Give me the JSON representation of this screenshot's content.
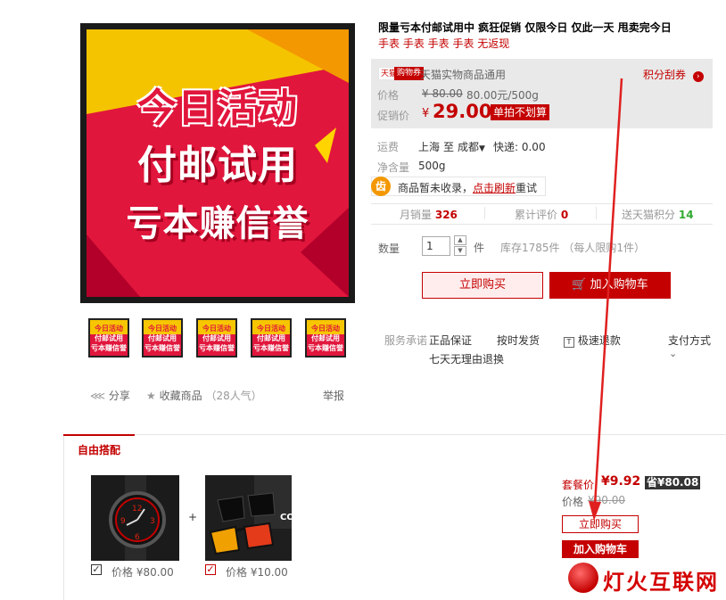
{
  "product": {
    "title": "限量亏本付邮试用中 疯狂促销 仅限今日 仅此一天 甩卖完今日",
    "subtitle": "手表 手表 手表 手表 无返现",
    "main_image_lines": [
      "今日活动",
      "付邮试用",
      "亏本赚信誉"
    ],
    "thumbnail_lines": [
      "今日活动",
      "付邮试用",
      "亏本赚信誉"
    ]
  },
  "price_panel": {
    "tmall_badge": "天猫",
    "badge2": "购物券",
    "coupon_text": "天猫实物商品通用",
    "points_link": "积分刮券",
    "price_label": "价格",
    "original_price": "¥ 80.00",
    "unit_price": "80.00元/500g",
    "promo_label": "促销价",
    "currency": "¥",
    "promo_price": "29.00",
    "promo_tag": "单拍不划算"
  },
  "shipping": {
    "label": "运费",
    "from": "上海",
    "to_word": "至",
    "to": "成都",
    "express": "快递: 0.00",
    "net_label": "净含量",
    "net_value": "500g"
  },
  "notice": {
    "icon_char": "齿",
    "text": "商品暂未收录，",
    "link": "点击刷新",
    "suffix": "重试"
  },
  "stats": {
    "monthly_label": "月销量",
    "monthly_value": "326",
    "reviews_label": "累计评价",
    "reviews_value": "0",
    "points_label": "送天猫积分",
    "points_value": "14"
  },
  "quantity": {
    "label": "数量",
    "value": "1",
    "unit": "件",
    "stock": "库存1785件 （每人限购1件）"
  },
  "buttons": {
    "buy_now": "立即购买",
    "add_cart": "加入购物车"
  },
  "services": {
    "label": "服务承诺",
    "genuine": "正品保证",
    "on_time": "按时发货",
    "fast_refund": "极速退款",
    "return7": "七天无理由退换",
    "payment": "支付方式"
  },
  "social": {
    "share": "分享",
    "favorite": "收藏商品",
    "popularity": "（28人气）",
    "report": "举报"
  },
  "combo": {
    "tab_label": "自由搭配",
    "items": [
      {
        "price": "价格 ¥80.00",
        "checked": true
      },
      {
        "price": "价格 ¥10.00",
        "checked": true
      }
    ],
    "plus": "+",
    "package_price_label": "套餐价",
    "package_price": "¥9.92",
    "save_tag": "省¥80.08",
    "original_label": "价格",
    "original_price": "¥90.00",
    "buy_now": "立即购买",
    "add_cart": "加入购物车"
  },
  "watermark": {
    "text": "灯火互联网"
  },
  "colors": {
    "accent_red": "#c40000",
    "green": "#33aa33",
    "promo_bg": "#f7c600"
  }
}
